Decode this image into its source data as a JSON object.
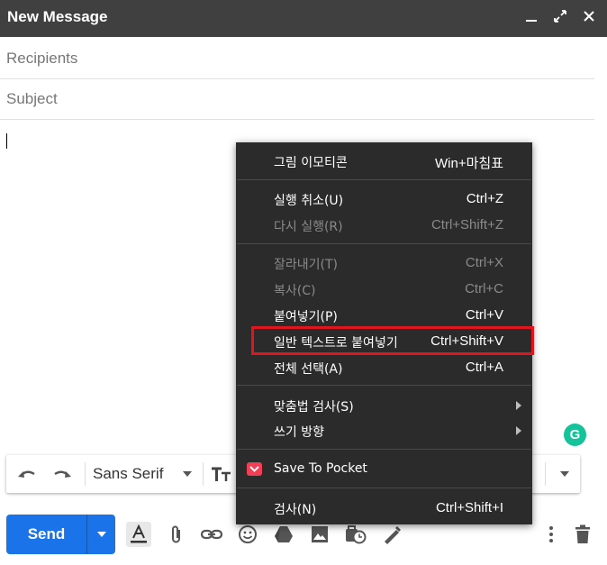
{
  "window": {
    "title": "New Message",
    "controls": [
      "minimize-icon",
      "expand-icon",
      "close-icon"
    ]
  },
  "fields": {
    "recipients_placeholder": "Recipients",
    "subject_placeholder": "Subject"
  },
  "format_toolbar": {
    "font": "Sans Serif",
    "icons": [
      "undo-icon",
      "redo-icon",
      "font-dropdown-icon",
      "text-size-icon",
      "more-formatting-icon"
    ]
  },
  "send": {
    "label": "Send"
  },
  "bottom_icons": [
    "text-color-icon",
    "attach-icon",
    "link-icon",
    "emoji-icon",
    "drive-icon",
    "photo-icon",
    "schedule-icon",
    "signature-icon",
    "more-options-icon",
    "trash-icon"
  ],
  "context_menu": {
    "items": [
      {
        "label": "그림 이모티콘",
        "shortcut": "Win+마침표",
        "disabled": false
      },
      {
        "label": "실행 취소(U)",
        "shortcut": "Ctrl+Z",
        "disabled": false
      },
      {
        "label": "다시 실행(R)",
        "shortcut": "Ctrl+Shift+Z",
        "disabled": true
      },
      {
        "label": "잘라내기(T)",
        "shortcut": "Ctrl+X",
        "disabled": true
      },
      {
        "label": "복사(C)",
        "shortcut": "Ctrl+C",
        "disabled": true
      },
      {
        "label": "붙여넣기(P)",
        "shortcut": "Ctrl+V",
        "disabled": false
      },
      {
        "label": "일반 텍스트로 붙여넣기",
        "shortcut": "Ctrl+Shift+V",
        "disabled": false
      },
      {
        "label": "전체 선택(A)",
        "shortcut": "Ctrl+A",
        "disabled": false
      },
      {
        "label": "맞춤법 검사(S)",
        "shortcut": "",
        "disabled": false
      },
      {
        "label": "쓰기 방향",
        "shortcut": "",
        "disabled": false
      },
      {
        "label": "Save To Pocket",
        "shortcut": "",
        "disabled": false
      },
      {
        "label": "검사(N)",
        "shortcut": "Ctrl+Shift+I",
        "disabled": false
      }
    ],
    "highlight_color": "#e0151e"
  },
  "colors": {
    "titlebar": "#404040",
    "send": "#1a73e8",
    "menu_bg": "#2b2b2b",
    "grammarly": "#15c39a"
  }
}
